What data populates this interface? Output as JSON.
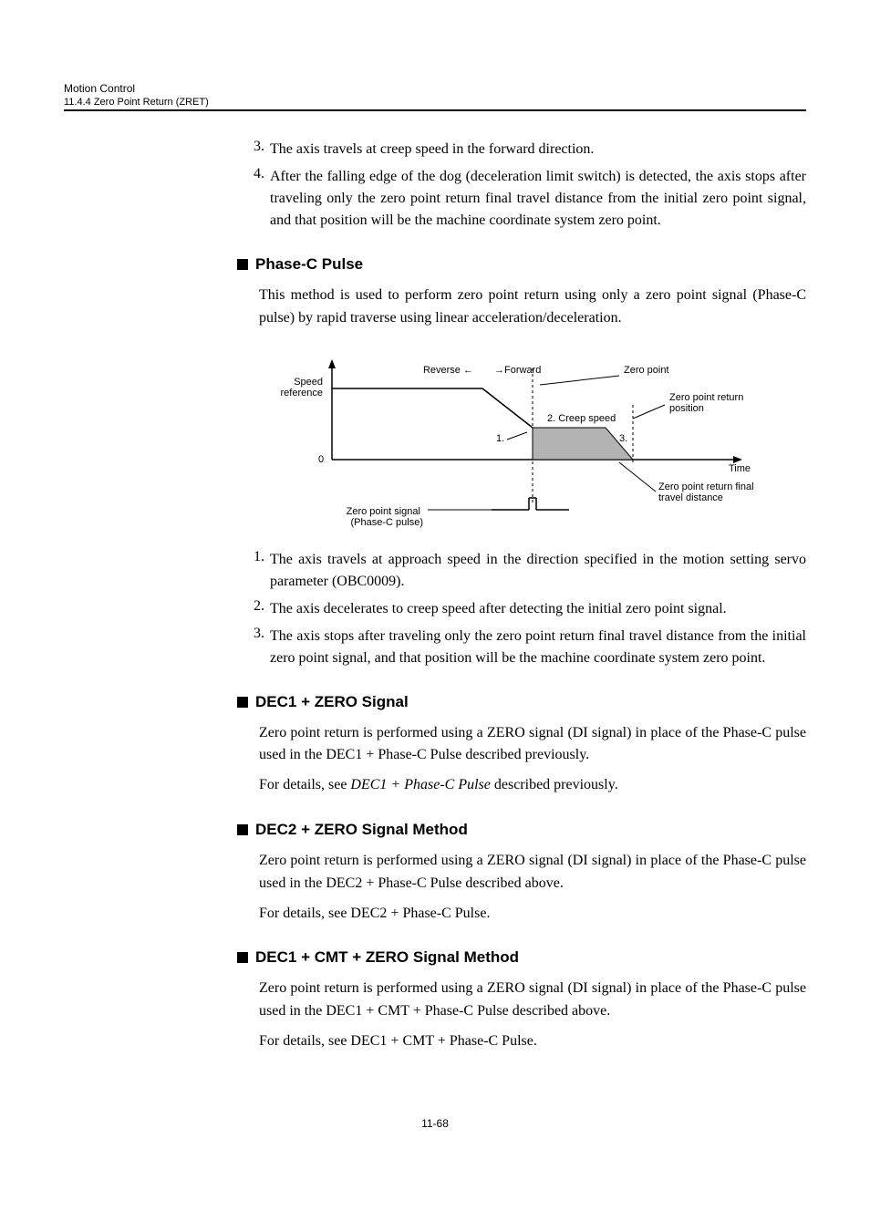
{
  "header": {
    "chapter": "Motion Control",
    "section": "11.4.4  Zero Point Return (ZRET)"
  },
  "top_list": {
    "items": [
      {
        "num": "3.",
        "text": "The axis travels at creep speed in the forward direction."
      },
      {
        "num": "4.",
        "text": "After the falling edge of the dog (deceleration limit switch) is detected, the axis stops after traveling only the zero point return final travel distance from the initial zero point signal, and that position will be the machine coordinate system zero point."
      }
    ]
  },
  "section_phase_c": {
    "title": "Phase-C Pulse",
    "para1": "This method is used to perform zero point return using only a zero point signal (Phase-C pulse) by rapid traverse using linear acceleration/deceleration.",
    "list": [
      {
        "num": "1.",
        "text": "The axis travels at approach speed in the direction specified in the motion setting servo parameter (OBC0009)."
      },
      {
        "num": "2.",
        "text": "The axis decelerates to creep speed after detecting the initial zero point signal."
      },
      {
        "num": "3.",
        "text": "The axis stops after traveling only the zero point return final travel distance from the initial zero point signal, and that position will be the machine coordinate system zero point."
      }
    ]
  },
  "diagram": {
    "speed_ref": "Speed\nreference",
    "zero_axis_label": "0",
    "reverse": "Reverse",
    "forward": "Forward",
    "zero_point": "Zero point",
    "creep_speed": "Creep speed",
    "num1": "1.",
    "num2": "2.",
    "num3": "3.",
    "zpr_pos": "Zero point return\nposition",
    "time": "Time",
    "zpr_final": "Zero point return final\ntravel distance",
    "zps_signal": "Zero point signal\n(Phase-C pulse)"
  },
  "section_dec1_zero": {
    "title": "DEC1 + ZERO Signal",
    "para1": "Zero point return is performed using a ZERO signal (DI signal) in place of the Phase-C pulse used in the DEC1 + Phase-C Pulse described previously.",
    "para2_a": "For details, see ",
    "para2_b": "DEC1 + Phase-C Pulse",
    "para2_c": " described previously."
  },
  "section_dec2_zero": {
    "title": "DEC2 + ZERO Signal Method",
    "para1": "Zero point return is performed using a ZERO signal (DI signal) in place of the Phase-C pulse used in the DEC2 + Phase-C Pulse described above.",
    "para2": "For details, see DEC2 + Phase-C Pulse."
  },
  "section_dec1_cmt_zero": {
    "title": "DEC1 + CMT + ZERO Signal Method",
    "para1": "Zero point return is performed using a ZERO signal (DI signal) in place of the Phase-C pulse used in the DEC1 + CMT + Phase-C Pulse described above.",
    "para2": "For details, see DEC1 + CMT + Phase-C Pulse."
  },
  "footer": {
    "page": "11-68"
  }
}
